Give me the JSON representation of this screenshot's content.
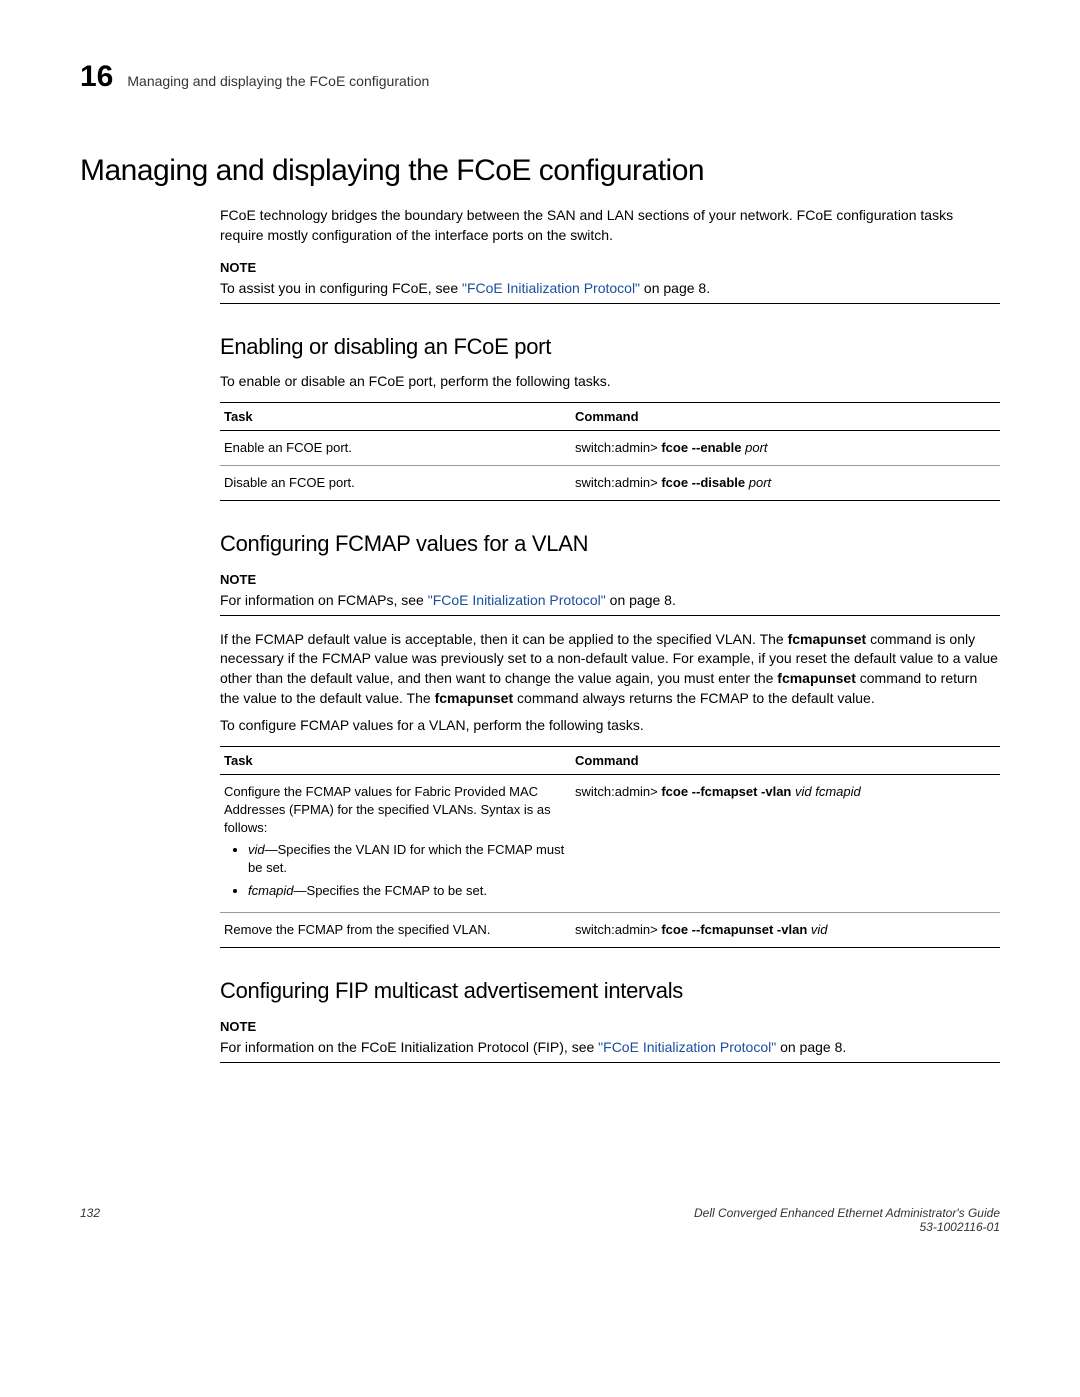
{
  "header": {
    "chapter_number": "16",
    "chapter_title": "Managing and displaying the FCoE configuration"
  },
  "main_heading": "Managing and displaying the FCoE configuration",
  "intro_paragraph": "FCoE technology bridges the boundary between the SAN and LAN sections of your network. FCoE configuration tasks require mostly configuration of the interface ports on the switch.",
  "note1": {
    "label": "NOTE",
    "prefix": "To assist you in configuring FCoE, see ",
    "link": "\"FCoE Initialization Protocol\"",
    "suffix": " on page 8."
  },
  "section_enable": {
    "heading": "Enabling or disabling an FCoE port",
    "intro": "To enable or disable an FCoE port, perform the following tasks.",
    "th_task": "Task",
    "th_cmd": "Command",
    "row1_task": "Enable an FCOE port.",
    "row1_cmd_prompt": "switch:admin> ",
    "row1_cmd_bold": "fcoe --enable",
    "row1_cmd_ital": " port",
    "row2_task": "Disable an FCOE port.",
    "row2_cmd_prompt": "switch:admin> ",
    "row2_cmd_bold": "fcoe --disable",
    "row2_cmd_ital": " port"
  },
  "section_fcmap": {
    "heading": "Configuring FCMAP values for a VLAN",
    "note_label": "NOTE",
    "note_prefix": "For information on FCMAPs, see ",
    "note_link": "\"FCoE Initialization Protocol\"",
    "note_suffix": " on page 8.",
    "para1_a": "If the FCMAP default value is acceptable, then it can be applied to the specified VLAN. The ",
    "para1_b": "fcmapunset",
    "para1_c": " command is only necessary if the FCMAP value was previously set to a non-default value. For example, if you reset the default value to a value other than the default value, and then want to change the value again, you must enter the ",
    "para1_d": "fcmapunset",
    "para1_e": " command to return the value to the default value. The ",
    "para1_f": "fcmapunset",
    "para1_g": " command always returns the FCMAP to the default value.",
    "para2": "To configure FCMAP values for a VLAN, perform the following tasks.",
    "th_task": "Task",
    "th_cmd": "Command",
    "row1_desc": "Configure the FCMAP values for Fabric Provided MAC Addresses (FPMA) for the specified VLANs. Syntax is as follows:",
    "row1_li1_term": "vid",
    "row1_li1_rest": "—Specifies the VLAN ID for which the FCMAP must be set.",
    "row1_li2_term": "fcmapid",
    "row1_li2_rest": "—Specifies the FCMAP to be set.",
    "row1_cmd_prompt": "switch:admin> ",
    "row1_cmd_bold": "fcoe --fcmapset -vlan",
    "row1_cmd_ital": " vid fcmapid",
    "row2_task": "Remove the FCMAP from the specified VLAN.",
    "row2_cmd_prompt": "switch:admin> ",
    "row2_cmd_bold": "fcoe --fcmapunset -vlan",
    "row2_cmd_ital": " vid"
  },
  "section_fip": {
    "heading": "Configuring FIP multicast advertisement intervals",
    "note_label": "NOTE",
    "note_prefix": "For information on the FCoE Initialization Protocol (FIP), see ",
    "note_link": "\"FCoE Initialization Protocol\"",
    "note_suffix": " on page 8."
  },
  "footer": {
    "page": "132",
    "doc_title": "Dell Converged Enhanced Ethernet Administrator's Guide",
    "doc_number": "53-1002116-01"
  }
}
